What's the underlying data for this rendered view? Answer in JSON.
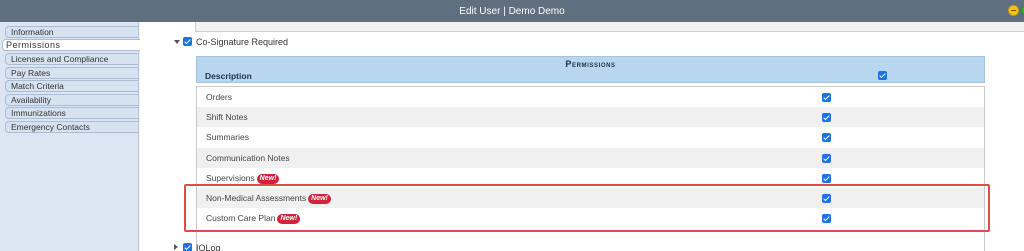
{
  "window": {
    "title": "Edit User | Demo Demo"
  },
  "sidebar": {
    "tabs": [
      {
        "label": "Information",
        "active": false
      },
      {
        "label": "Permissions",
        "active": true
      },
      {
        "label": "Licenses and Compliance",
        "active": false
      },
      {
        "label": "Pay Rates",
        "active": false
      },
      {
        "label": "Match Criteria",
        "active": false
      },
      {
        "label": "Availability",
        "active": false
      },
      {
        "label": "Immunizations",
        "active": false
      },
      {
        "label": "Emergency Contacts",
        "active": false
      }
    ]
  },
  "co_signature": {
    "label": "Co-Signature Required",
    "checked": true
  },
  "permissions": {
    "title": "Permissions",
    "description_header": "Description",
    "header_checked": true,
    "rows": [
      {
        "label": "Orders",
        "badge": "",
        "checked": true
      },
      {
        "label": "Shift Notes",
        "badge": "",
        "checked": true
      },
      {
        "label": "Summaries",
        "badge": "",
        "checked": true
      },
      {
        "label": "Communication Notes",
        "badge": "",
        "checked": true
      },
      {
        "label": "Supervisions",
        "badge": "New!",
        "checked": true
      },
      {
        "label": "Non-Medical Assessments",
        "badge": "New!",
        "checked": true
      },
      {
        "label": "Custom Care Plan",
        "badge": "New!",
        "checked": true
      }
    ]
  },
  "iolog": {
    "label": "IOLog",
    "checked": true
  },
  "colors": {
    "titlebar": "#5f6f80",
    "header": "#b9d6f0",
    "badge": "#d0243a",
    "highlight": "#e24b4b",
    "checkbox": "#1a73e8"
  }
}
